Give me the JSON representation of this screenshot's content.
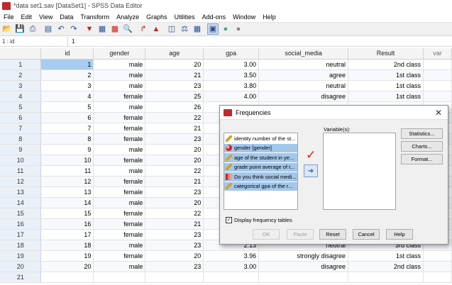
{
  "window": {
    "title": "*data set1.sav [DataSet1] - SPSS Data Editor"
  },
  "menu": [
    "File",
    "Edit",
    "View",
    "Data",
    "Transform",
    "Analyze",
    "Graphs",
    "Utilities",
    "Add-ons",
    "Window",
    "Help"
  ],
  "refbar": {
    "cell_name": "1 : id",
    "cell_value": "1"
  },
  "grid": {
    "columns": [
      "id",
      "gender",
      "age",
      "gpa",
      "social_media",
      "Result",
      "var"
    ],
    "rows": [
      [
        "1",
        "1",
        "male",
        "20",
        "3.00",
        "neutral",
        "2nd class"
      ],
      [
        "2",
        "2",
        "male",
        "21",
        "3.50",
        "agree",
        "1st class"
      ],
      [
        "3",
        "3",
        "male",
        "23",
        "3.80",
        "neutral",
        "1st class"
      ],
      [
        "4",
        "4",
        "female",
        "25",
        "4.00",
        "disagree",
        "1st class"
      ],
      [
        "5",
        "5",
        "male",
        "26",
        "",
        "",
        ""
      ],
      [
        "6",
        "6",
        "female",
        "22",
        "",
        "",
        ""
      ],
      [
        "7",
        "7",
        "female",
        "21",
        "",
        "",
        ""
      ],
      [
        "8",
        "8",
        "female",
        "23",
        "",
        "",
        ""
      ],
      [
        "9",
        "9",
        "male",
        "20",
        "",
        "",
        ""
      ],
      [
        "10",
        "10",
        "female",
        "20",
        "",
        "",
        ""
      ],
      [
        "11",
        "11",
        "male",
        "22",
        "",
        "",
        ""
      ],
      [
        "12",
        "12",
        "female",
        "21",
        "",
        "",
        ""
      ],
      [
        "13",
        "13",
        "female",
        "23",
        "",
        "",
        ""
      ],
      [
        "14",
        "14",
        "male",
        "20",
        "",
        "",
        ""
      ],
      [
        "15",
        "15",
        "female",
        "22",
        "",
        "",
        ""
      ],
      [
        "16",
        "16",
        "female",
        "21",
        "",
        "",
        ""
      ],
      [
        "17",
        "17",
        "female",
        "23",
        "",
        "",
        ""
      ],
      [
        "18",
        "18",
        "male",
        "23",
        "2.13",
        "neutral",
        "3rd class"
      ],
      [
        "19",
        "19",
        "female",
        "20",
        "3.96",
        "strongly disagree",
        "1st class"
      ],
      [
        "20",
        "20",
        "male",
        "23",
        "3.00",
        "disagree",
        "2nd class"
      ],
      [
        "21",
        "",
        "",
        "",
        "",
        "",
        ""
      ]
    ]
  },
  "dialog": {
    "title": "Frequencies",
    "variables_label": "Variable(s):",
    "source_variables": [
      {
        "label": "identity number of the st...",
        "icon": "ruler-icon"
      },
      {
        "label": "gender  [gender]",
        "icon": "nominal-icon"
      },
      {
        "label": "age of the student in ye...",
        "icon": "ruler-icon"
      },
      {
        "label": "grade point average of t...",
        "icon": "ruler-icon"
      },
      {
        "label": "Do you think social medi...",
        "icon": "ordinal-icon"
      },
      {
        "label": "categorical gpa of the r...",
        "icon": "ruler-icon"
      }
    ],
    "side_buttons": [
      "Statistics...",
      "Charts...",
      "Format..."
    ],
    "checkbox_label": "Display frequency tables",
    "checkbox_checked": true,
    "bottom_buttons": [
      "OK",
      "Paste",
      "Reset",
      "Cancel",
      "Help"
    ]
  }
}
